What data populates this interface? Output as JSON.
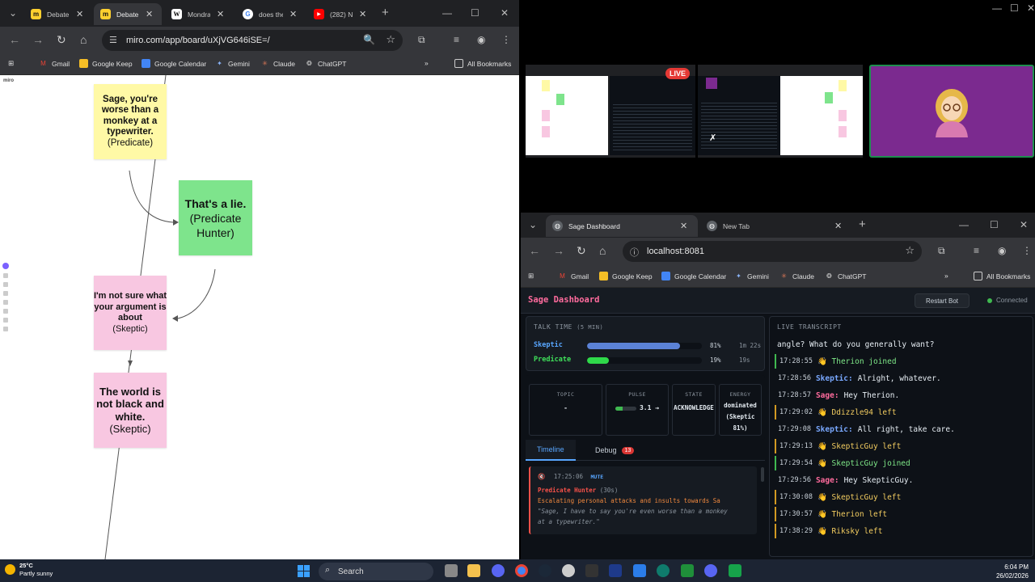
{
  "left_browser": {
    "tabs": [
      {
        "label": "Debate",
        "icon": "miro-icon",
        "active": false
      },
      {
        "label": "Debate",
        "icon": "miro-icon",
        "active": true
      },
      {
        "label": "Mondra",
        "icon": "wikipedia-icon",
        "active": false
      },
      {
        "label": "does the",
        "icon": "google-icon",
        "active": false
      },
      {
        "label": "(282) Ne",
        "icon": "youtube-icon",
        "active": false
      }
    ],
    "url": "miro.com/app/board/uXjVG646iSE=/",
    "bookmarks": [
      "Gmail",
      "Google Keep",
      "Google Calendar",
      "Gemini",
      "Claude",
      "ChatGPT"
    ],
    "all_bookmarks": "All Bookmarks"
  },
  "miro": {
    "logo": "miro",
    "stickies": [
      {
        "text": "Sage, you're worse than a monkey at a typewriter.",
        "role": "(Predicate)",
        "color": "#fff9a6"
      },
      {
        "text": "That's a lie.",
        "role": "(Predicate Hunter)",
        "color": "#7ee48c"
      },
      {
        "text": "I'm not sure what your argument is about",
        "role": "(Skeptic)",
        "color": "#f8c7e1"
      },
      {
        "text": "The world is not black and white.",
        "role": "(Skeptic)",
        "color": "#f8c7e1"
      }
    ]
  },
  "meeting": {
    "live_badge": "LIVE"
  },
  "right_browser": {
    "tabs": [
      {
        "label": "Sage Dashboard",
        "active": true
      },
      {
        "label": "New Tab",
        "active": false
      }
    ],
    "url": "localhost:8081",
    "bookmarks": [
      "Gmail",
      "Google Keep",
      "Google Calendar",
      "Gemini",
      "Claude",
      "ChatGPT"
    ],
    "all_bookmarks": "All Bookmarks"
  },
  "dashboard": {
    "title": "Sage Dashboard",
    "restart_label": "Restart Bot",
    "status": "Connected",
    "talk_time": {
      "title": "TALK TIME",
      "window": "(5 MIN)",
      "rows": [
        {
          "name": "Skeptic",
          "pct": 81,
          "pct_label": "81%",
          "time": "1m 22s",
          "color": "#58a6ff",
          "bar": "#5b82d6"
        },
        {
          "name": "Predicate",
          "pct": 19,
          "pct_label": "19%",
          "time": "19s",
          "color": "#3fe05a",
          "bar": "#2fd94a"
        }
      ]
    },
    "stats": [
      {
        "label": "TOPIC",
        "value": "-"
      },
      {
        "label": "PULSE",
        "value": "3.1 →",
        "pulse_fraction": 0.35
      },
      {
        "label": "STATE",
        "value": "ACKNOWLEDGE"
      },
      {
        "label": "ENERGY",
        "value": "dominated (Skeptic 81%)"
      }
    ],
    "tabs": [
      {
        "label": "Timeline",
        "active": true
      },
      {
        "label": "Debug",
        "badge": "13"
      }
    ],
    "event": {
      "time": "17:25:06",
      "tag": "MUTE",
      "speaker": "Predicate Hunter",
      "duration": "(30s)",
      "reason": "Escalating personal attacks and insults towards Sa",
      "quote1": "\"Sage, I have to say you're even worse than a monkey",
      "quote2": "at a typewriter.\""
    },
    "transcript": {
      "title": "LIVE TRANSCRIPT",
      "partial": "angle? What do you generally want?",
      "lines": [
        {
          "time": "17:28:55",
          "speaker": "",
          "text": "👋 Therion joined",
          "kind": "join"
        },
        {
          "time": "17:28:56",
          "speaker": "Skeptic:",
          "text": "Alright, whatever.",
          "kind": "msg",
          "spk_color": "#79a8ff"
        },
        {
          "time": "17:28:57",
          "speaker": "Sage:",
          "text": "Hey Therion.",
          "kind": "msg",
          "spk_color": "#ff6b9d"
        },
        {
          "time": "17:29:02",
          "speaker": "",
          "text": "👋 Ddizzle94 left",
          "kind": "evt"
        },
        {
          "time": "17:29:08",
          "speaker": "Skeptic:",
          "text": "All right, take care.",
          "kind": "msg",
          "spk_color": "#79a8ff"
        },
        {
          "time": "17:29:13",
          "speaker": "",
          "text": "👋 SkepticGuy left",
          "kind": "evt"
        },
        {
          "time": "17:29:54",
          "speaker": "",
          "text": "👋 SkepticGuy joined",
          "kind": "join"
        },
        {
          "time": "17:29:56",
          "speaker": "Sage:",
          "text": "Hey SkepticGuy.",
          "kind": "msg",
          "spk_color": "#ff6b9d"
        },
        {
          "time": "17:30:08",
          "speaker": "",
          "text": "👋 SkepticGuy left",
          "kind": "evt"
        },
        {
          "time": "17:30:57",
          "speaker": "",
          "text": "👋 Therion left",
          "kind": "evt"
        },
        {
          "time": "17:38:29",
          "speaker": "",
          "text": "👋 Riksky left",
          "kind": "evt"
        }
      ]
    }
  },
  "taskbar": {
    "temp": "25°C",
    "weather": "Partly sunny",
    "search": "Search",
    "time": "6:04 PM",
    "date": "26/02/2026"
  }
}
